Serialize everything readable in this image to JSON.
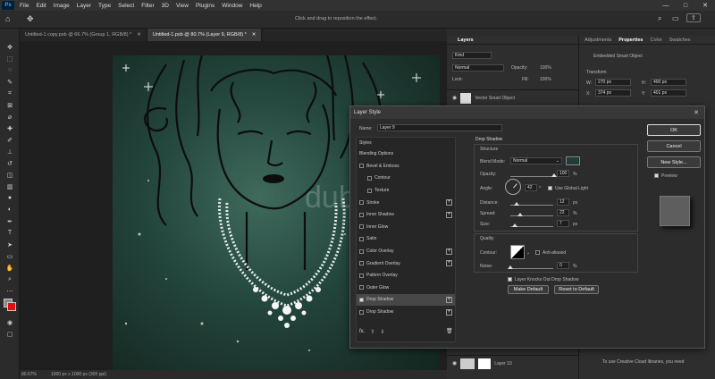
{
  "menu": {
    "items": [
      "File",
      "Edit",
      "Image",
      "Layer",
      "Type",
      "Select",
      "Filter",
      "3D",
      "View",
      "Plugins",
      "Window",
      "Help"
    ],
    "logo": "Ps"
  },
  "window_controls": [
    "—",
    "□",
    "✕"
  ],
  "options_bar": {
    "hint": "Click and drag to reposition the effect."
  },
  "doc_tabs": [
    {
      "label": "Untitled-1 copy.psb @ 66.7% (Group 1, RGB/8) *",
      "close": "✕"
    },
    {
      "label": "Untitled-1.psb @ 80.7% (Layer 9, RGB/8) *",
      "close": "✕"
    }
  ],
  "watermark": "dubizzle",
  "status": {
    "zoom": "80.67%",
    "doc": "1000 px x 1000 px (300 ppi)"
  },
  "layers": {
    "tab": "Layers",
    "search": "Kind",
    "blend": "Normal",
    "opacity_label": "Opacity:",
    "opacity": "100%",
    "fill_label": "Fill:",
    "fill": "100%",
    "lock_label": "Lock:",
    "top_item": "Vector Smart Object",
    "bottom_item": "Layer 10",
    "drop_shadow_item": "Drop Shadow"
  },
  "properties": {
    "tabs": [
      "Adjustments",
      "Properties",
      "Color",
      "Swatches"
    ],
    "obj": "Embedded Smart Object",
    "transform": "Transform",
    "w_label": "W:",
    "w": "270 px",
    "h_label": "H:",
    "h": "400 px",
    "x_label": "X:",
    "x": "374 px",
    "y_label": "Y:",
    "y": "401 px",
    "cc": "To use Creative Cloud libraries, you need"
  },
  "dialog": {
    "title": "Layer Style",
    "close": "✕",
    "name_label": "Name:",
    "name_value": "Layer 9",
    "styles_header": "Styles",
    "blending_options": "Blending Options",
    "style_items": [
      {
        "label": "Bevel & Emboss",
        "checked": false,
        "plus": false
      },
      {
        "label": "Contour",
        "checked": false,
        "plus": false,
        "indent": true
      },
      {
        "label": "Texture",
        "checked": false,
        "plus": false,
        "indent": true
      },
      {
        "label": "Stroke",
        "checked": false,
        "plus": true
      },
      {
        "label": "Inner Shadow",
        "checked": false,
        "plus": true
      },
      {
        "label": "Inner Glow",
        "checked": false,
        "plus": false
      },
      {
        "label": "Satin",
        "checked": false,
        "plus": false
      },
      {
        "label": "Color Overlay",
        "checked": false,
        "plus": true
      },
      {
        "label": "Gradient Overlay",
        "checked": false,
        "plus": true
      },
      {
        "label": "Pattern Overlay",
        "checked": false,
        "plus": false
      },
      {
        "label": "Outer Glow",
        "checked": false,
        "plus": false
      },
      {
        "label": "Drop Shadow",
        "checked": true,
        "plus": true,
        "selected": true
      },
      {
        "label": "Drop Shadow",
        "checked": false,
        "plus": true
      }
    ],
    "fx": "fx.",
    "section": "Drop Shadow",
    "structure": "Structure",
    "blend_mode_label": "Blend Mode:",
    "blend_mode": "Normal",
    "opacity_label": "Opacity:",
    "opacity": "100",
    "angle_label": "Angle:",
    "angle": "42",
    "use_global_light": "Use Global Light",
    "distance_label": "Distance:",
    "distance": "12",
    "spread_label": "Spread:",
    "spread": "22",
    "size_label": "Size:",
    "size": "7",
    "quality": "Quality",
    "contour_label": "Contour:",
    "anti_aliased": "Anti-aliased",
    "noise_label": "Noise:",
    "noise": "0",
    "pct": "%",
    "px": "px",
    "deg": "°",
    "knocks_out": "Layer Knocks Out Drop Shadow",
    "make_default": "Make Default",
    "reset_default": "Reset to Default",
    "ok": "OK",
    "cancel": "Cancel",
    "new_style": "New Style...",
    "preview": "Preview"
  },
  "colors": {
    "shadow_color": "#1f3d36",
    "accent": "#31a8ff"
  }
}
